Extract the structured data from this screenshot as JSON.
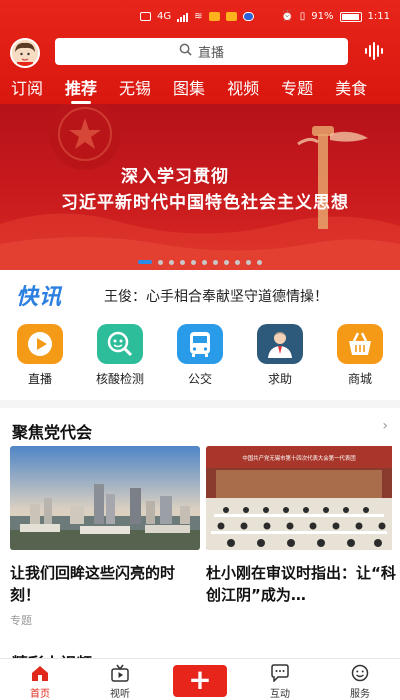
{
  "status_bar": {
    "signal_text": "4G",
    "battery": "91%",
    "time": "1:11"
  },
  "header": {
    "search_placeholder": "直播",
    "avatar_icon": "user-avatar",
    "voice_icon": "audio-wave-icon"
  },
  "channels": [
    {
      "label": "订阅",
      "active": false
    },
    {
      "label": "推荐",
      "active": true
    },
    {
      "label": "无锡",
      "active": false
    },
    {
      "label": "图集",
      "active": false
    },
    {
      "label": "视频",
      "active": false
    },
    {
      "label": "专题",
      "active": false
    },
    {
      "label": "美食",
      "active": false
    }
  ],
  "banner": {
    "line1": "深入学习贯彻",
    "line2": "习近平新时代中国特色社会主义思想",
    "dot_count": 11,
    "active_dot": 0
  },
  "news_flash": {
    "logo": "快讯",
    "text": "王俊：心手相合奉献坚守道德情操！"
  },
  "services": [
    {
      "label": "直播",
      "icon": "play-icon",
      "color": "#f59a16"
    },
    {
      "label": "核酸检测",
      "icon": "test-search-icon",
      "color": "#2ebd9a"
    },
    {
      "label": "公交",
      "icon": "bus-icon",
      "color": "#2a9be8"
    },
    {
      "label": "求助",
      "icon": "person-help-icon",
      "color": "#2d5a7a"
    },
    {
      "label": "商城",
      "icon": "basket-icon",
      "color": "#f59a16"
    }
  ],
  "section": {
    "title": "聚焦党代会",
    "more": "›",
    "articles": [
      {
        "title": "让我们回眸这些闪亮的时刻！",
        "tag": "专题"
      },
      {
        "title": "杜小刚在审议时指出：让“科创江阴”成为…",
        "tag": "",
        "image_banner": "中国共产党无锡市第十四次代表大会第一代表团"
      }
    ],
    "next_title": "精彩小视频"
  },
  "tabbar": [
    {
      "label": "首页",
      "icon": "home-icon",
      "active": true
    },
    {
      "label": "视听",
      "icon": "tv-icon",
      "active": false
    },
    {
      "label": "",
      "icon": "plus-icon",
      "active": false
    },
    {
      "label": "互动",
      "icon": "chat-bubble-icon",
      "active": false
    },
    {
      "label": "服务",
      "icon": "smile-icon",
      "active": false
    }
  ]
}
